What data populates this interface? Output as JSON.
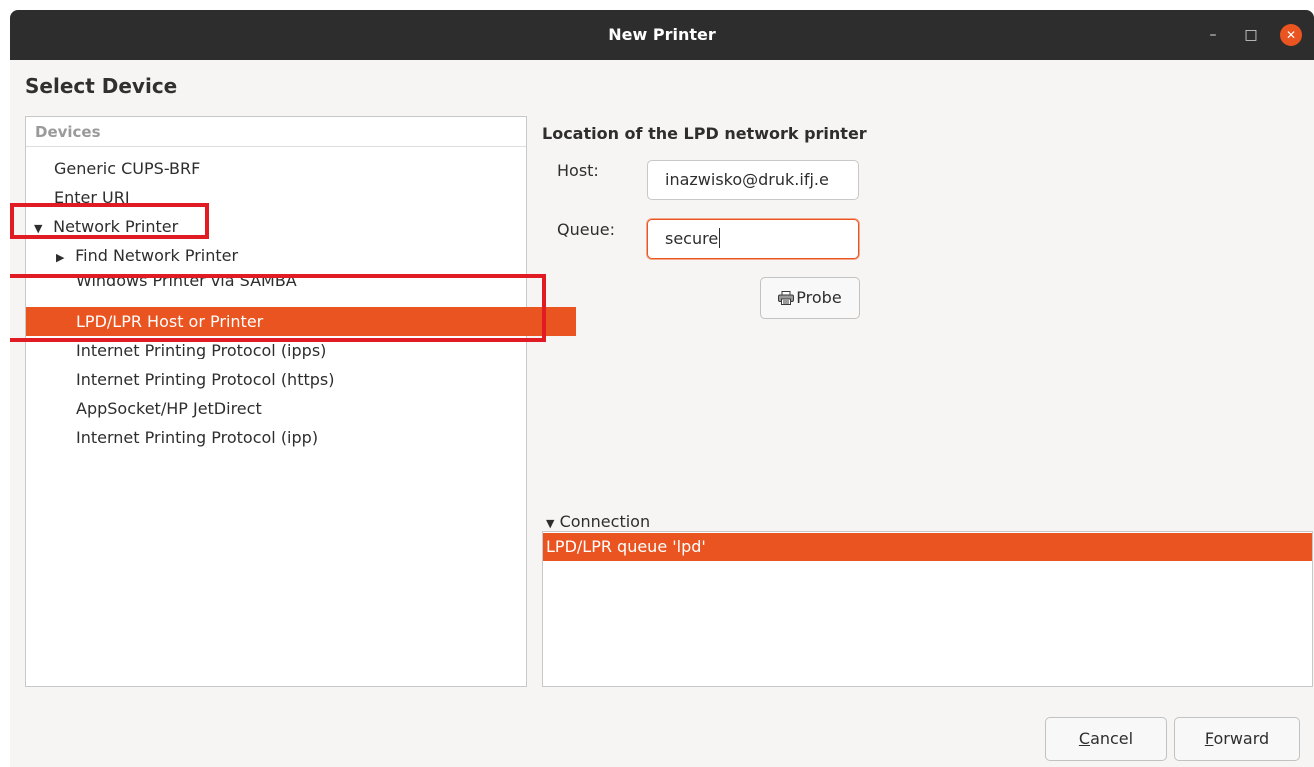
{
  "window": {
    "title": "New Printer",
    "minimize_glyph": "–",
    "maximize_glyph": "□",
    "close_glyph": "✕"
  },
  "page": {
    "heading": "Select Device"
  },
  "devices": {
    "header": "Devices",
    "items": [
      {
        "label": "Generic CUPS-BRF"
      },
      {
        "label": "Enter URI"
      },
      {
        "label": "Network Printer",
        "expanded": true
      },
      {
        "label": "Find Network Printer",
        "expanded": false
      },
      {
        "label": "Windows Printer via SAMBA"
      },
      {
        "label": "LPD/LPR Host or Printer",
        "selected": true
      },
      {
        "label": "Internet Printing Protocol (ipps)"
      },
      {
        "label": "Internet Printing Protocol (https)"
      },
      {
        "label": "AppSocket/HP JetDirect"
      },
      {
        "label": "Internet Printing Protocol (ipp)"
      }
    ]
  },
  "lpd": {
    "title": "Location of the LPD network printer",
    "host_label": "Host:",
    "host_value": "inazwisko@druk.ifj.e",
    "queue_label": "Queue:",
    "queue_value": "secure",
    "probe_label": "Probe"
  },
  "connection": {
    "toggle_label": "Connection",
    "items": [
      {
        "label": "LPD/LPR queue 'lpd'",
        "selected": true
      }
    ]
  },
  "buttons": {
    "cancel_mnemonic": "C",
    "cancel_rest": "ancel",
    "forward_mnemonic": "F",
    "forward_rest": "orward"
  },
  "colors": {
    "accent": "#e95420",
    "annotation": "#e01b24",
    "titlebar": "#2d2d2d"
  }
}
